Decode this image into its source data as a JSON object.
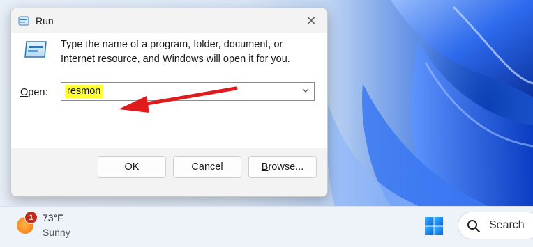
{
  "dialog": {
    "title": "Run",
    "close_glyph": "✕",
    "description": "Type the name of a program, folder, document, or Internet resource, and Windows will open it for you.",
    "open_label_accel": "O",
    "open_label_rest": "pen:",
    "input_value": "resmon",
    "buttons": {
      "ok": "OK",
      "cancel": "Cancel",
      "browse_accel": "B",
      "browse_rest": "rowse..."
    },
    "icons": {
      "title_icon": "run-icon",
      "content_icon": "run-icon",
      "dropdown_icon": "chevron-down-icon"
    }
  },
  "annotation": {
    "color": "#e01b1b",
    "highlight_color": "#ffff33"
  },
  "taskbar": {
    "weather": {
      "badge_count": "1",
      "temperature": "73°F",
      "condition": "Sunny"
    },
    "search_label": "Search",
    "icons": [
      "weather-icon",
      "windows-start-icon",
      "search-icon"
    ]
  }
}
